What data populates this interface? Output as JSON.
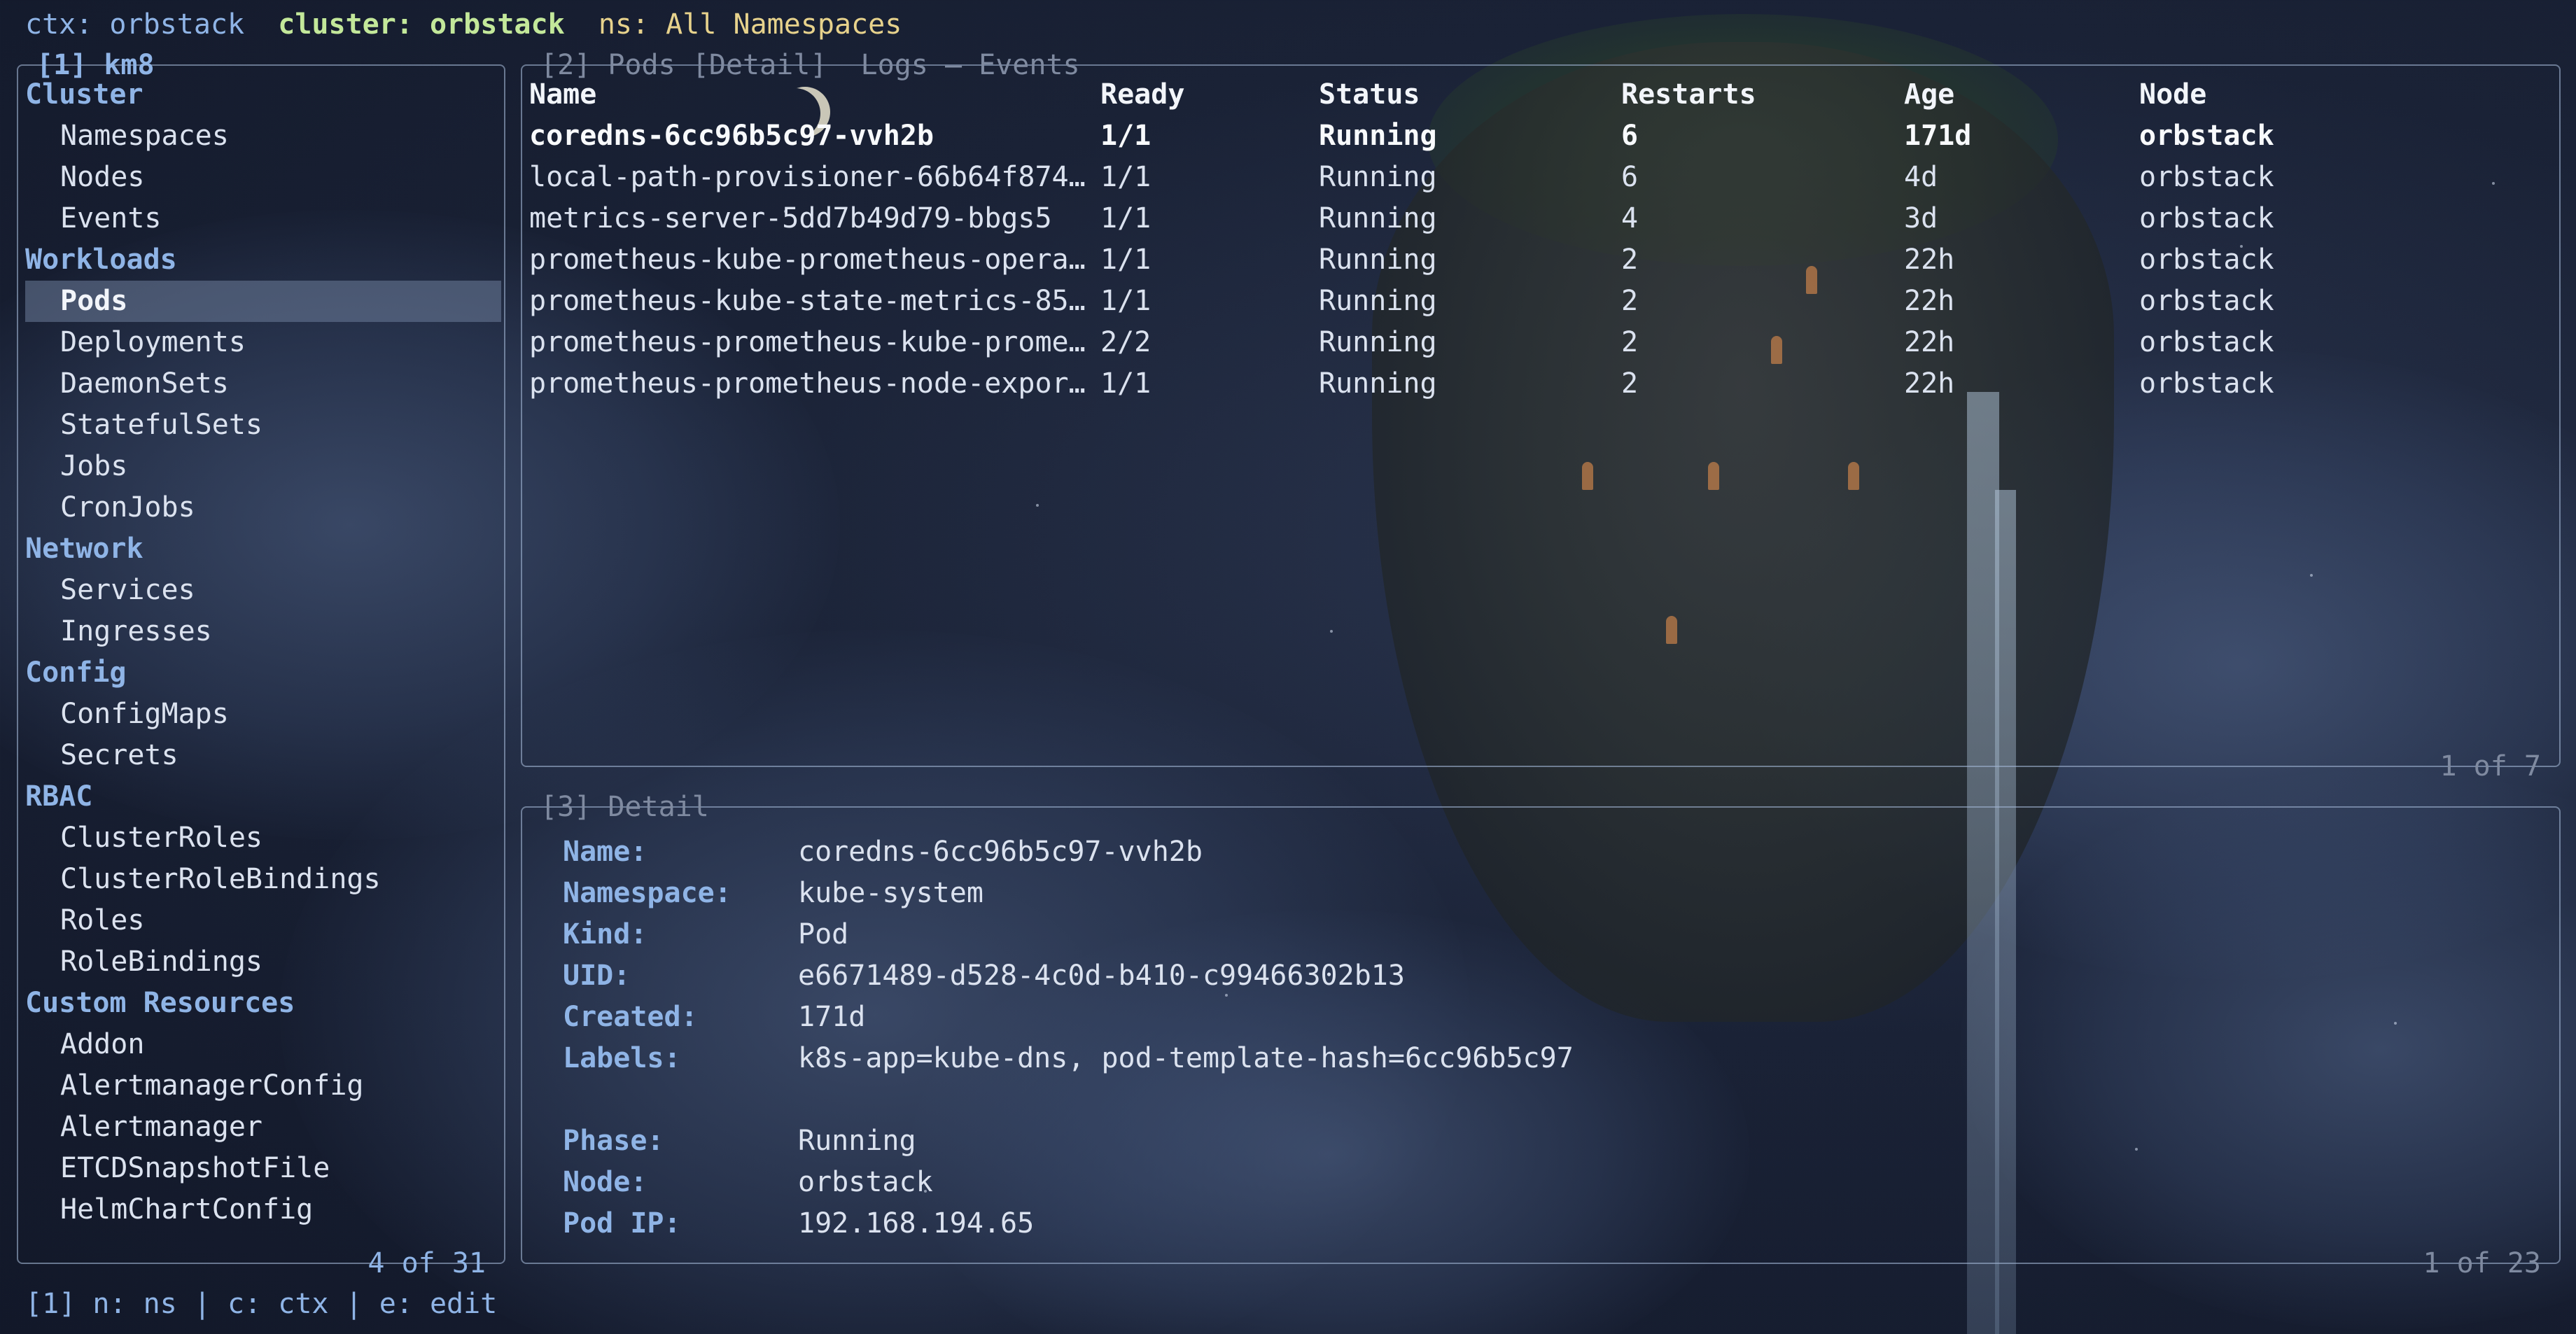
{
  "topbar": {
    "ctx": "ctx: orbstack",
    "cluster": "cluster: orbstack",
    "ns": "ns: All Namespaces"
  },
  "sidebar": {
    "title": "[1] km8",
    "footer": "4 of 31",
    "sections": [
      {
        "label": "Cluster",
        "items": [
          "Namespaces",
          "Nodes",
          "Events"
        ]
      },
      {
        "label": "Workloads",
        "items": [
          "Pods",
          "Deployments",
          "DaemonSets",
          "StatefulSets",
          "Jobs",
          "CronJobs"
        ]
      },
      {
        "label": "Network",
        "items": [
          "Services",
          "Ingresses"
        ]
      },
      {
        "label": "Config",
        "items": [
          "ConfigMaps",
          "Secrets"
        ]
      },
      {
        "label": "RBAC",
        "items": [
          "ClusterRoles",
          "ClusterRoleBindings",
          "Roles",
          "RoleBindings"
        ]
      },
      {
        "label": "Custom Resources",
        "items": [
          "Addon",
          "AlertmanagerConfig",
          "Alertmanager",
          "ETCDSnapshotFile",
          "HelmChartConfig"
        ]
      }
    ],
    "active": "Pods"
  },
  "pods": {
    "title": "[2] Pods [Detail]  Logs – Events",
    "footer": "1 of 7",
    "columns": [
      "Name",
      "Ready",
      "Status",
      "Restarts",
      "Age",
      "Node"
    ],
    "rows": [
      [
        "coredns-6cc96b5c97-vvh2b",
        "1/1",
        "Running",
        "6",
        "171d",
        "orbstack"
      ],
      [
        "local-path-provisioner-66b64f874…",
        "1/1",
        "Running",
        "6",
        "4d",
        "orbstack"
      ],
      [
        "metrics-server-5dd7b49d79-bbgs5",
        "1/1",
        "Running",
        "4",
        "3d",
        "orbstack"
      ],
      [
        "prometheus-kube-prometheus-opera…",
        "1/1",
        "Running",
        "2",
        "22h",
        "orbstack"
      ],
      [
        "prometheus-kube-state-metrics-85…",
        "1/1",
        "Running",
        "2",
        "22h",
        "orbstack"
      ],
      [
        "prometheus-prometheus-kube-prome…",
        "2/2",
        "Running",
        "2",
        "22h",
        "orbstack"
      ],
      [
        "prometheus-prometheus-node-expor…",
        "1/1",
        "Running",
        "2",
        "22h",
        "orbstack"
      ]
    ]
  },
  "detail": {
    "title": "[3] Detail",
    "footer": "1 of 23",
    "fields": [
      {
        "key": "Name:",
        "value": "coredns-6cc96b5c97-vvh2b"
      },
      {
        "key": "Namespace:",
        "value": "kube-system"
      },
      {
        "key": "Kind:",
        "value": "Pod"
      },
      {
        "key": "UID:",
        "value": "e6671489-d528-4c0d-b410-c99466302b13"
      },
      {
        "key": "Created:",
        "value": "171d"
      },
      {
        "key": "Labels:",
        "value": "k8s-app=kube-dns, pod-template-hash=6cc96b5c97"
      },
      {
        "key": "",
        "value": ""
      },
      {
        "key": "Phase:",
        "value": "Running"
      },
      {
        "key": "Node:",
        "value": "orbstack"
      },
      {
        "key": "Pod IP:",
        "value": "192.168.194.65"
      }
    ]
  },
  "statusbar": {
    "text": "[1] n: ns | c: ctx | e: edit"
  }
}
